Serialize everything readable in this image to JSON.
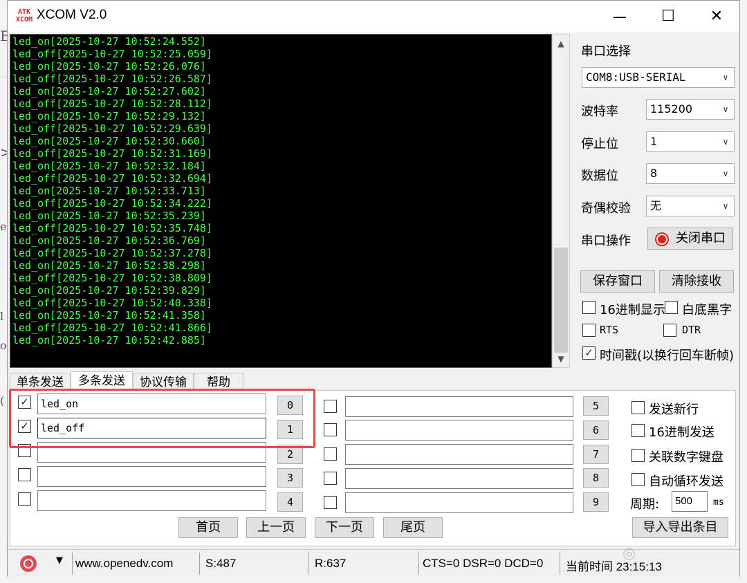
{
  "window": {
    "title": "XCOM V2.0",
    "icon_text_top": "ATK",
    "icon_text_bottom": "XCOM"
  },
  "terminal": {
    "lines": [
      "led_on[2025-10-27 10:52:24.552]",
      "led_off[2025-10-27 10:52:25.059]",
      "led_on[2025-10-27 10:52:26.076]",
      "led_off[2025-10-27 10:52:26.587]",
      "led_on[2025-10-27 10:52:27.602]",
      "led_off[2025-10-27 10:52:28.112]",
      "led_on[2025-10-27 10:52:29.132]",
      "led_off[2025-10-27 10:52:29.639]",
      "led_on[2025-10-27 10:52:30.660]",
      "led_off[2025-10-27 10:52:31.169]",
      "led_on[2025-10-27 10:52:32.184]",
      "led_off[2025-10-27 10:52:32.694]",
      "led_on[2025-10-27 10:52:33.713]",
      "led_off[2025-10-27 10:52:34.222]",
      "led_on[2025-10-27 10:52:35.239]",
      "led_off[2025-10-27 10:52:35.748]",
      "led_on[2025-10-27 10:52:36.769]",
      "led_off[2025-10-27 10:52:37.278]",
      "led_on[2025-10-27 10:52:38.298]",
      "led_off[2025-10-27 10:52:38.809]",
      "led_on[2025-10-27 10:52:39.829]",
      "led_off[2025-10-27 10:52:40.338]",
      "led_on[2025-10-27 10:52:41.358]",
      "led_off[2025-10-27 10:52:41.866]",
      "led_on[2025-10-27 10:52:42.885]"
    ]
  },
  "settings": {
    "port_label": "串口选择",
    "port_value": "COM8:USB-SERIAL",
    "baud_label": "波特率",
    "baud_value": "115200",
    "stopbits_label": "停止位",
    "stopbits_value": "1",
    "databits_label": "数据位",
    "databits_value": "8",
    "parity_label": "奇偶校验",
    "parity_value": "无",
    "operation_label": "串口操作",
    "close_port_label": "关闭串口",
    "save_window_label": "保存窗口",
    "clear_receive_label": "清除接收",
    "hex_display_label": "16进制显示",
    "white_bg_label": "白底黑字",
    "rts_label": "RTS",
    "dtr_label": "DTR",
    "timestamp_label": "时间戳(以换行回车断帧)"
  },
  "tabs": [
    "单条发送",
    "多条发送",
    "协议传输",
    "帮助"
  ],
  "multi_send": {
    "left_rows": [
      {
        "text": "led_on",
        "button": "0"
      },
      {
        "text": "led_off",
        "button": "1"
      },
      {
        "text": "",
        "button": "2"
      },
      {
        "text": "",
        "button": "3"
      },
      {
        "text": "",
        "button": "4"
      }
    ],
    "right_rows": [
      {
        "text": "",
        "button": "5"
      },
      {
        "text": "",
        "button": "6"
      },
      {
        "text": "",
        "button": "7"
      },
      {
        "text": "",
        "button": "8"
      },
      {
        "text": "",
        "button": "9"
      }
    ],
    "send_newline_label": "发送新行",
    "hex_send_label": "16进制发送",
    "numpad_label": "关联数字键盘",
    "auto_loop_label": "自动循环发送",
    "period_label": "周期:",
    "period_value": "500",
    "period_unit": "ms",
    "first_page": "首页",
    "prev_page": "上一页",
    "next_page": "下一页",
    "last_page": "尾页",
    "import_export": "导入导出条目"
  },
  "status": {
    "website": "www.openedv.com",
    "sent": "S:487",
    "received": "R:637",
    "lines": "CTS=0 DSR=0 DCD=0",
    "time": "当前时间 23:15:13"
  },
  "colors": {
    "terminal_text": "#4cff4c",
    "terminal_bg": "#000000",
    "highlight": "#e8474d",
    "indicator_red": "#e02020"
  }
}
